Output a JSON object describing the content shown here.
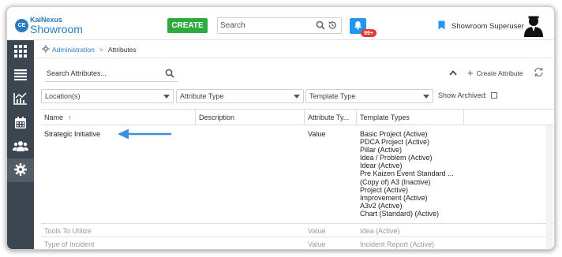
{
  "app": {
    "logo_badge": "CE",
    "logo_top": "KaiNexus",
    "logo_bottom": "Showroom"
  },
  "header": {
    "create_label": "CREATE",
    "search_placeholder": "Search",
    "notification_count": "99+",
    "user_name": "Showroom Superuser"
  },
  "sidebar": {
    "items": [
      {
        "icon": "apps-grid-icon",
        "active": false
      },
      {
        "icon": "list-icon",
        "active": false
      },
      {
        "icon": "chart-icon",
        "active": false
      },
      {
        "icon": "calendar-icon",
        "active": false
      },
      {
        "icon": "users-icon",
        "active": false
      },
      {
        "icon": "gear-icon",
        "active": true
      }
    ]
  },
  "breadcrumb": {
    "parent": "Administration",
    "current": "Attributes"
  },
  "toolbar": {
    "search_placeholder": "Search Attributes...",
    "create_attribute": "Create Attribute"
  },
  "filters": {
    "locations": "Location(s)",
    "attribute_type": "Attribute Type",
    "template_type": "Template Type",
    "show_archived": "Show Archived:"
  },
  "table": {
    "columns": [
      "Name",
      "Description",
      "Attribute Ty...",
      "Template Types",
      ""
    ],
    "rows": [
      {
        "name": "Strategic Initiative",
        "description": "",
        "attribute_type": "Value",
        "template_types": [
          "Basic Project (Active)",
          "PDCA Project (Active)",
          "Pillar (Active)",
          "Idea / Problem (Active)",
          "Idear (Active)",
          "Pre Kaizen Event Standard ...",
          "(Copy of) A3 (Inactive)",
          "Project (Active)",
          "Improvement (Active)",
          "A3v2 (Active)",
          "Chart (Standard) (Active)"
        ]
      },
      {
        "name": "Tools To Utilize",
        "description": "",
        "attribute_type": "Value",
        "template_types": [
          "Idea (Active)"
        ]
      },
      {
        "name": "Type of Incident",
        "description": "",
        "attribute_type": "Value",
        "template_types": [
          "Incident Report (Active)"
        ]
      }
    ]
  },
  "colors": {
    "accent_blue": "#2a7bbf",
    "create_green": "#2eaa3f",
    "sidebar_dark": "#3c4650",
    "arrow_blue": "#3d8fdc"
  }
}
